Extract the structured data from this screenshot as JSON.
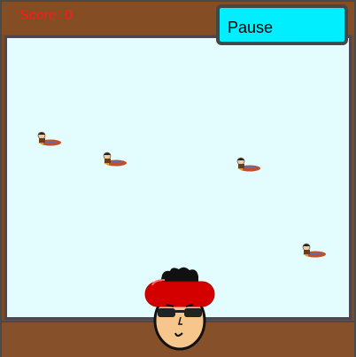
{
  "hud": {
    "score_text": "Score: 0",
    "pause_label": "Pause"
  },
  "colors": {
    "score": "#ff1a1a",
    "pause_button": "#00eeff",
    "border": "#464646",
    "wood": "#844d24",
    "water": "#e3fdff",
    "headband": "#d40000"
  },
  "sprites": {
    "enemy": "rocket-rider-icon",
    "player": "player-avatar-icon"
  }
}
